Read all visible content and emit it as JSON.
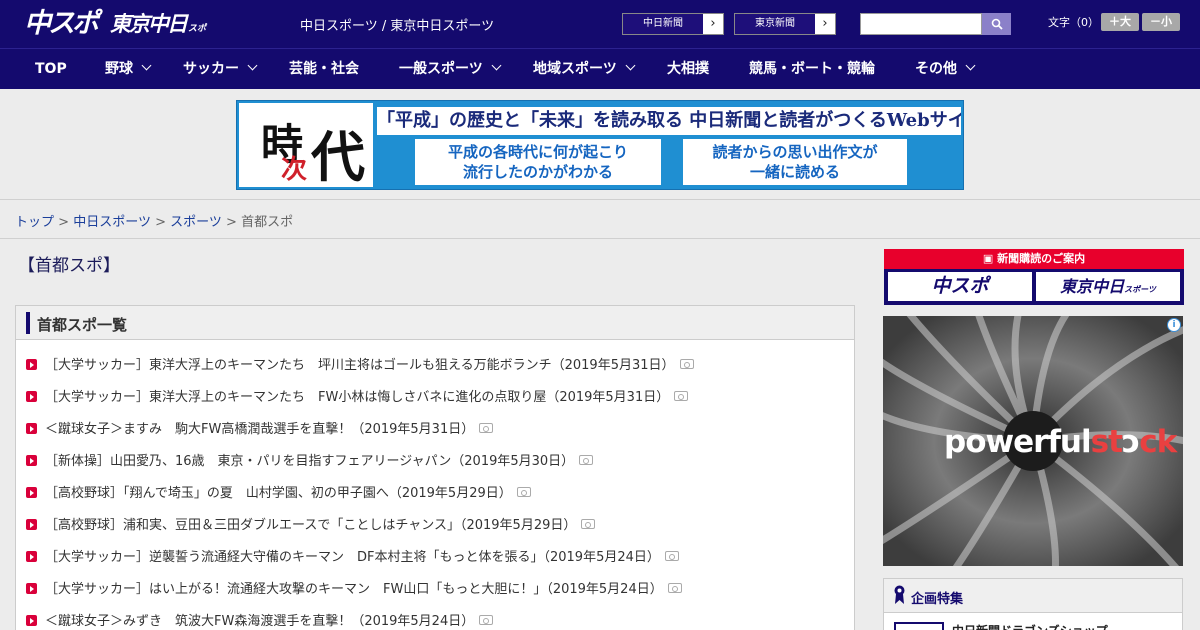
{
  "header": {
    "logo_chuspo": "中スポ",
    "logo_tokyo": "東京中日",
    "logo_tokyo_sub": "スポーツ",
    "site_links": "中日スポーツ / 東京中日スポーツ",
    "chunichi_button": "中日新聞",
    "tokyo_button": "東京新聞",
    "search_placeholder": "",
    "font_size_label": "文字（0）",
    "font_bigger": "＋大",
    "font_smaller": "－小"
  },
  "nav": {
    "items": [
      {
        "label": "TOP"
      },
      {
        "label": "野球"
      },
      {
        "label": "サッカー"
      },
      {
        "label": "芸能・社会"
      },
      {
        "label": "一般スポーツ"
      },
      {
        "label": "地域スポーツ"
      },
      {
        "label": "大相撲"
      },
      {
        "label": "競馬・ボート・競輪"
      },
      {
        "label": "その他"
      }
    ]
  },
  "banner": {
    "kanji_1": "時",
    "kanji_2": "次",
    "kanji_3": "代",
    "headline": "「平成」の歴史と「未来」を読み取る 中日新聞と読者がつくるWebサイト",
    "sub_left_1": "平成の各時代に何が起こり",
    "sub_left_2": "流行したのかがわかる",
    "sub_right_1": "読者からの思い出作文が",
    "sub_right_2": "一緒に読める",
    "colors": {
      "background": "#1f8fd2",
      "kanji_red": "#d0202a"
    }
  },
  "breadcrumb": {
    "items": [
      {
        "label": "トップ"
      },
      {
        "label": "中日スポーツ"
      },
      {
        "label": "スポーツ"
      }
    ],
    "separator": ">",
    "current": "首都スポ"
  },
  "main": {
    "page_title": "【首都スポ】",
    "list_title": "首都スポ一覧",
    "articles": [
      {
        "title": "［大学サッカー］東洋大浮上のキーマンたち　坪川主将はゴールも狙える万能ボランチ（2019年5月31日）"
      },
      {
        "title": "［大学サッカー］東洋大浮上のキーマンたち　FW小林は悔しさバネに進化の点取り屋（2019年5月31日）"
      },
      {
        "title": "＜蹴球女子＞ますみ　駒大FW高橋潤哉選手を直撃！（2019年5月31日）"
      },
      {
        "title": "［新体操］山田愛乃、16歳　東京・パリを目指すフェアリージャパン（2019年5月30日）"
      },
      {
        "title": "［高校野球］「翔んで埼玉」の夏　山村学園、初の甲子園へ（2019年5月29日）"
      },
      {
        "title": "［高校野球］浦和実、豆田＆三田ダブルエースで「ことしはチャンス」（2019年5月29日）"
      },
      {
        "title": "［大学サッカー］逆襲誓う流通経大守備のキーマン　DF本村主将「もっと体を張る」（2019年5月24日）"
      },
      {
        "title": "［大学サッカー］はい上がる！流通経大攻撃のキーマン　FW山口「もっと大胆に！」（2019年5月24日）"
      },
      {
        "title": "＜蹴球女子＞みずき　筑波大FW森海渡選手を直撃！（2019年5月24日）"
      }
    ]
  },
  "sidebar": {
    "subscribe_title": "新聞購読のご案内",
    "subscribe_chuspo": "中スポ",
    "subscribe_tokyo": "東京中日",
    "subscribe_tokyo_sub": "スポーツ",
    "ad_info": "i",
    "ad_brand_1": "powerful",
    "ad_brand_2": "st",
    "ad_brand_3": "ck",
    "feature_title": "企画特集",
    "feature_item": "中日新聞ドラゴンズショップ"
  }
}
